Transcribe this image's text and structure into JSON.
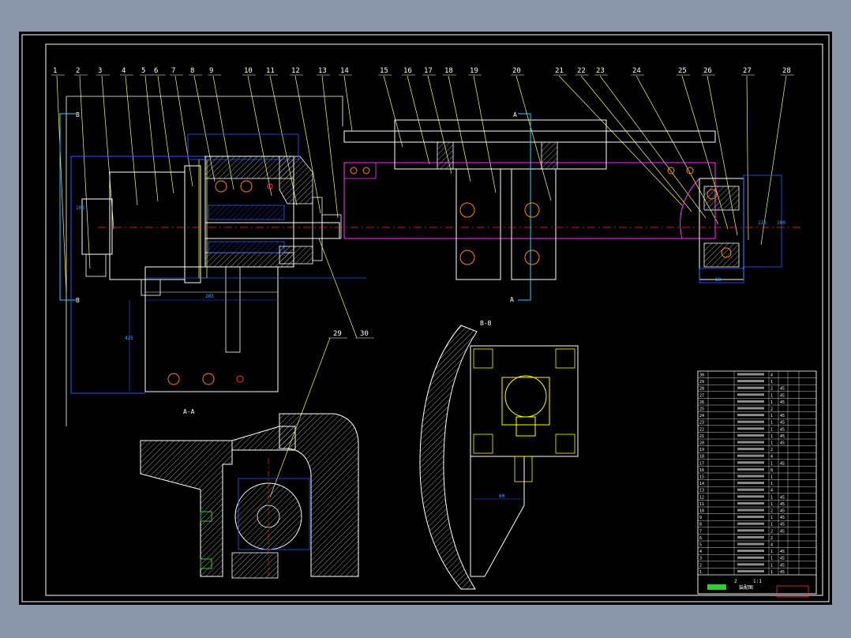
{
  "background_color": "#8b97a8",
  "sheet_color": "#000000",
  "colors": {
    "frame": "#ffffff",
    "leader": "#ffff66",
    "outline": "#ffffff",
    "hatch": "#ffffff",
    "magenta": "#ff33ff",
    "blue": "#3355ff",
    "centerline": "#ff3333",
    "bolt": "#ff8800",
    "yellow": "#ffff00",
    "cyan": "#33ccff",
    "green": "#33cc33"
  },
  "balloons": [
    "1",
    "2",
    "3",
    "4",
    "5",
    "6",
    "7",
    "8",
    "9",
    "10",
    "11",
    "12",
    "13",
    "14",
    "15",
    "16",
    "17",
    "18",
    "19",
    "20",
    "21",
    "22",
    "23",
    "24",
    "25",
    "26",
    "27",
    "28"
  ],
  "balloons_bottom": [
    "29",
    "30"
  ],
  "section_labels": {
    "aa": "A-A",
    "bb": "B-B",
    "a_top": "A",
    "a_bottom": "A",
    "b_top": "B",
    "b_bottom": "B"
  },
  "dimensions": {
    "d1": "108",
    "d2": "285",
    "d3": "425",
    "d4": "60",
    "d5": "60",
    "d6": "60",
    "d7": "126",
    "d8": "100"
  },
  "title_block": {
    "rows": [
      {
        "no": "30",
        "qty": "4"
      },
      {
        "no": "29",
        "qty": "1"
      },
      {
        "no": "28",
        "qty": "2",
        "mat": "45"
      },
      {
        "no": "27",
        "qty": "1",
        "mat": "45"
      },
      {
        "no": "26",
        "qty": "1",
        "mat": "45"
      },
      {
        "no": "25",
        "qty": "2"
      },
      {
        "no": "24",
        "qty": "1",
        "mat": "45"
      },
      {
        "no": "23",
        "qty": "1",
        "mat": "45"
      },
      {
        "no": "22",
        "qty": "1",
        "mat": "45"
      },
      {
        "no": "21",
        "qty": "1",
        "mat": "45"
      },
      {
        "no": "20",
        "qty": "1",
        "mat": "45"
      },
      {
        "no": "19",
        "qty": "2"
      },
      {
        "no": "18",
        "qty": "4"
      },
      {
        "no": "17",
        "qty": "1",
        "mat": "45"
      },
      {
        "no": "16",
        "qty": "8"
      },
      {
        "no": "15",
        "qty": "1"
      },
      {
        "no": "14",
        "qty": "1"
      },
      {
        "no": "13",
        "qty": "4"
      },
      {
        "no": "12",
        "qty": "1",
        "mat": "45"
      },
      {
        "no": "11",
        "qty": "1",
        "mat": "45"
      },
      {
        "no": "10",
        "qty": "2",
        "mat": "45"
      },
      {
        "no": "9",
        "qty": "1",
        "mat": "45"
      },
      {
        "no": "8",
        "qty": "1",
        "mat": "45"
      },
      {
        "no": "7",
        "qty": "2",
        "mat": "45"
      },
      {
        "no": "6",
        "qty": "2"
      },
      {
        "no": "5",
        "qty": "4"
      },
      {
        "no": "4",
        "qty": "1",
        "mat": "45"
      },
      {
        "no": "3",
        "qty": "1",
        "mat": "45"
      },
      {
        "no": "2",
        "qty": "1",
        "mat": "45"
      },
      {
        "no": "1",
        "qty": "1",
        "mat": "45"
      }
    ],
    "sheet_scale": "1:1",
    "sheet_count": "2",
    "drawing_name": "装配图"
  }
}
